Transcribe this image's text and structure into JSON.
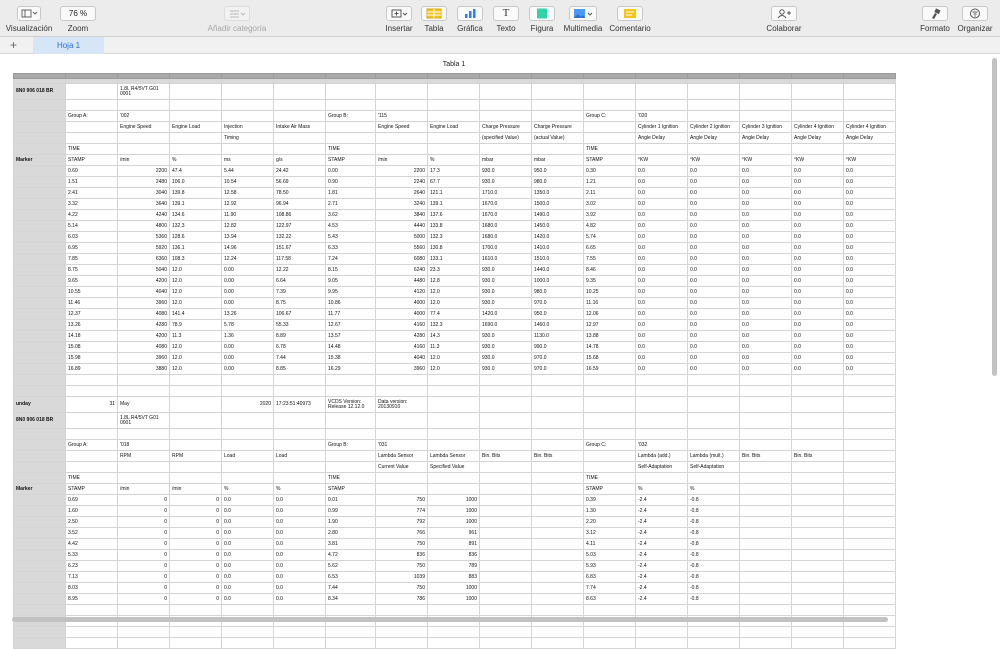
{
  "toolbar": {
    "view": "Visualización",
    "zoom_value": "76 %",
    "zoom": "Zoom",
    "add_category": "Añadir categoría",
    "insert": "Insertar",
    "table": "Tabla",
    "chart": "Gráfica",
    "text": "Texto",
    "shape": "Figura",
    "media": "Multimedia",
    "comment": "Comentario",
    "collaborate": "Colaborar",
    "format": "Formato",
    "organize": "Organizar",
    "text_icon_glyph": "T",
    "accent_color": "#f5c518",
    "shape_color": "#2ed3a8"
  },
  "tabs": {
    "add": "+",
    "sheet1": "Hoja 1"
  },
  "table_title": "Tabla 1",
  "rows": [
    [
      "8N0 906 018 BR",
      "",
      "1.8L R4/5VT     G01\n0001",
      "",
      "",
      "",
      "",
      "",
      "",
      "",
      "",
      "",
      "",
      "",
      "",
      "",
      ""
    ],
    [
      "",
      "",
      "",
      "",
      "",
      "",
      "",
      "",
      "",
      "",
      "",
      "",
      "",
      "",
      "",
      "",
      ""
    ],
    [
      "",
      "Group A:",
      "'002",
      "",
      "",
      "",
      "Group B:",
      "'115",
      "",
      "",
      "",
      "Group C:",
      "'020",
      "",
      "",
      "",
      ""
    ],
    [
      "",
      "",
      "Engine Speed",
      "Engine Load",
      "Injection",
      "Intake Air Mass",
      "",
      "Engine Speed",
      "Engine Load",
      "Charge Pressure",
      "Charge Pressure",
      "",
      "Cylinder 1 Ignition",
      "Cylinder 2 Ignition",
      "Cylinder 3 Ignition",
      "Cylinder 4 Ignition",
      "Cylinder 4 Ignition"
    ],
    [
      "",
      "",
      "",
      "",
      "Timing",
      "",
      "",
      "",
      "",
      "(specified Value)",
      "(actual Value)",
      "",
      "Angle Delay",
      "Angle Delay",
      "Angle Delay",
      "Angle Delay",
      "Angle Delay"
    ],
    [
      "",
      "TIME",
      "",
      "",
      "",
      "",
      "TIME",
      "",
      "",
      "",
      "",
      "TIME",
      "",
      "",
      "",
      "",
      ""
    ],
    [
      "Marker",
      "STAMP",
      "/min",
      "%",
      "ms",
      "g/s",
      "STAMP",
      "/min",
      "%",
      "mbar",
      "mbar",
      "STAMP",
      "°KW",
      "°KW",
      "°KW",
      "°KW",
      "°KW"
    ],
    [
      "",
      "0.60",
      "2200",
      "47.4",
      "5.44",
      "24.42",
      "0.00",
      "2200",
      "17.3",
      "930.0",
      "950.0",
      "0.30",
      "0.0",
      "0.0",
      "0.0",
      "0.0",
      "0.0"
    ],
    [
      "",
      "1.51",
      "2480",
      "106.0",
      "10.54",
      "56.69",
      "0.90",
      "2240",
      "67.7",
      "930.0",
      "980.0",
      "1.21",
      "0.0",
      "0.0",
      "0.0",
      "0.0",
      "0.0"
    ],
    [
      "",
      "2.41",
      "3040",
      "139.8",
      "12.58",
      "78.50",
      "1.81",
      "2640",
      "121.1",
      "1710.0",
      "1350.0",
      "2.11",
      "0.0",
      "0.0",
      "0.0",
      "0.0",
      "0.0"
    ],
    [
      "",
      "3.32",
      "3640",
      "139.1",
      "12.92",
      "96.94",
      "2.71",
      "3240",
      "139.1",
      "1670.0",
      "1500.0",
      "3.02",
      "0.0",
      "0.0",
      "0.0",
      "0.0",
      "0.0"
    ],
    [
      "",
      "4.22",
      "4240",
      "134.6",
      "11.90",
      "108.86",
      "3.62",
      "3840",
      "137.6",
      "1670.0",
      "1490.0",
      "3.92",
      "0.0",
      "0.0",
      "0.0",
      "0.0",
      "0.0"
    ],
    [
      "",
      "5.14",
      "4800",
      "132.3",
      "12.82",
      "122.97",
      "4.53",
      "4440",
      "133.8",
      "1680.0",
      "1450.0",
      "4.82",
      "0.0",
      "0.0",
      "0.0",
      "0.0",
      "0.0"
    ],
    [
      "",
      "6.03",
      "5360",
      "128.6",
      "13.94",
      "132.22",
      "5.43",
      "5000",
      "132.3",
      "1680.0",
      "1420.0",
      "5.74",
      "0.0",
      "0.0",
      "0.0",
      "0.0",
      "0.0"
    ],
    [
      "",
      "6.95",
      "5920",
      "136.1",
      "14.96",
      "151.67",
      "6.33",
      "5560",
      "130.8",
      "1700.0",
      "1410.0",
      "6.65",
      "0.0",
      "0.0",
      "0.0",
      "0.0",
      "0.0"
    ],
    [
      "",
      "7.85",
      "6360",
      "108.3",
      "12.24",
      "117.58",
      "7.24",
      "6080",
      "133.1",
      "1610.0",
      "1510.0",
      "7.55",
      "0.0",
      "0.0",
      "0.0",
      "0.0",
      "0.0"
    ],
    [
      "",
      "8.75",
      "5040",
      "12.0",
      "0.00",
      "12.22",
      "8.15",
      "6240",
      "23.3",
      "930.0",
      "1440.0",
      "8.46",
      "0.0",
      "0.0",
      "0.0",
      "0.0",
      "0.0"
    ],
    [
      "",
      "9.65",
      "4200",
      "12.0",
      "0.00",
      "6.64",
      "9.05",
      "4480",
      "12.8",
      "930.0",
      "1000.0",
      "9.35",
      "0.0",
      "0.0",
      "0.0",
      "0.0",
      "0.0"
    ],
    [
      "",
      "10.55",
      "4040",
      "12.0",
      "0.00",
      "7.39",
      "9.95",
      "4120",
      "12.0",
      "930.0",
      "980.0",
      "10.25",
      "0.0",
      "0.0",
      "0.0",
      "0.0",
      "0.0"
    ],
    [
      "",
      "11.46",
      "3960",
      "12.0",
      "0.00",
      "8.75",
      "10.86",
      "4000",
      "12.0",
      "930.0",
      "970.0",
      "11.16",
      "0.0",
      "0.0",
      "0.0",
      "0.0",
      "0.0"
    ],
    [
      "",
      "12.37",
      "4080",
      "141.4",
      "13.26",
      "106.67",
      "11.77",
      "4000",
      "77.4",
      "1420.0",
      "950.0",
      "12.06",
      "0.0",
      "0.0",
      "0.0",
      "0.0",
      "0.0"
    ],
    [
      "",
      "13.26",
      "4280",
      "78.9",
      "5.78",
      "55.33",
      "12.67",
      "4160",
      "132.3",
      "1690.0",
      "1460.0",
      "12.97",
      "0.0",
      "0.0",
      "0.0",
      "0.0",
      "0.0"
    ],
    [
      "",
      "14.18",
      "4200",
      "11.3",
      "1.36",
      "8.89",
      "13.57",
      "4280",
      "14.3",
      "930.0",
      "1130.0",
      "13.88",
      "0.0",
      "0.0",
      "0.0",
      "0.0",
      "0.0"
    ],
    [
      "",
      "15.08",
      "4080",
      "12.0",
      "0.00",
      "6.78",
      "14.48",
      "4160",
      "11.3",
      "930.0",
      "990.0",
      "14.78",
      "0.0",
      "0.0",
      "0.0",
      "0.0",
      "0.0"
    ],
    [
      "",
      "15.98",
      "3960",
      "12.0",
      "0.00",
      "7.44",
      "15.38",
      "4040",
      "12.0",
      "930.0",
      "970.0",
      "15.68",
      "0.0",
      "0.0",
      "0.0",
      "0.0",
      "0.0"
    ],
    [
      "",
      "16.89",
      "3880",
      "12.0",
      "0.00",
      "8.85",
      "16.29",
      "3960",
      "12.0",
      "930.0",
      "970.0",
      "16.59",
      "0.0",
      "0.0",
      "0.0",
      "0.0",
      "0.0"
    ],
    [
      "",
      "",
      "",
      "",
      "",
      "",
      "",
      "",
      "",
      "",
      "",
      "",
      "",
      "",
      "",
      "",
      ""
    ],
    [
      "",
      "",
      "",
      "",
      "",
      "",
      "",
      "",
      "",
      "",
      "",
      "",
      "",
      "",
      "",
      "",
      ""
    ],
    [
      "unday",
      "31",
      "May",
      "",
      "2020",
      "17:23:51:40973",
      "VCDS Version:\nRelease 12.12.0",
      "Data version:\n20130910",
      "",
      "",
      "",
      "",
      "",
      "",
      "",
      "",
      ""
    ],
    [
      "8N0 906 018 BR",
      "",
      "1.8L R4/5VT     G01\n0001",
      "",
      "",
      "",
      "",
      "",
      "",
      "",
      "",
      "",
      "",
      "",
      "",
      "",
      ""
    ],
    [
      "",
      "",
      "",
      "",
      "",
      "",
      "",
      "",
      "",
      "",
      "",
      "",
      "",
      "",
      "",
      "",
      ""
    ],
    [
      "",
      "Group A:",
      "'018",
      "",
      "",
      "",
      "Group B:",
      "'031",
      "",
      "",
      "",
      "Group C:",
      "'032",
      "",
      "",
      "",
      ""
    ],
    [
      "",
      "",
      "RPM",
      "RPM",
      "Load",
      "Load",
      "",
      "Lambda Sensor",
      "Lambda Sensor",
      "Bin. Bits",
      "Bin. Bits",
      "",
      "Lambda (add.)",
      "Lambda (mult.)",
      "Bin. Bits",
      "Bin. Bits",
      ""
    ],
    [
      "",
      "",
      "",
      "",
      "",
      "",
      "",
      "Current Value",
      "Specified Value",
      "",
      "",
      "",
      "Self-Adaptation",
      "Self-Adaptation",
      "",
      "",
      ""
    ],
    [
      "",
      "TIME",
      "",
      "",
      "",
      "",
      "TIME",
      "",
      "",
      "",
      "",
      "TIME",
      "",
      "",
      "",
      "",
      ""
    ],
    [
      "Marker",
      "STAMP",
      "/min",
      "/min",
      "%",
      "%",
      "STAMP",
      "",
      "",
      "",
      "",
      "STAMP",
      "%",
      "%",
      "",
      "",
      ""
    ],
    [
      "",
      "0.69",
      "0",
      "0",
      "0.0",
      "0.0",
      "0.01",
      "750",
      "1000",
      "",
      "",
      "0.39",
      "-2.4",
      "-0.8",
      "",
      "",
      ""
    ],
    [
      "",
      "1.60",
      "0",
      "0",
      "0.0",
      "0.0",
      "0.99",
      "774",
      "1000",
      "",
      "",
      "1.30",
      "-2.4",
      "-0.8",
      "",
      "",
      ""
    ],
    [
      "",
      "2.50",
      "0",
      "0",
      "0.0",
      "0.0",
      "1.90",
      "792",
      "1000",
      "",
      "",
      "2.20",
      "-2.4",
      "-0.8",
      "",
      "",
      ""
    ],
    [
      "",
      "3.52",
      "0",
      "0",
      "0.0",
      "0.0",
      "2.80",
      "766",
      "961",
      "",
      "",
      "3.12",
      "-2.4",
      "-0.8",
      "",
      "",
      ""
    ],
    [
      "",
      "4.42",
      "0",
      "0",
      "0.0",
      "0.0",
      "3.81",
      "750",
      "891",
      "",
      "",
      "4.11",
      "-2.4",
      "-0.8",
      "",
      "",
      ""
    ],
    [
      "",
      "5.33",
      "0",
      "0",
      "0.0",
      "0.0",
      "4.72",
      "836",
      "836",
      "",
      "",
      "5.03",
      "-2.4",
      "-0.8",
      "",
      "",
      ""
    ],
    [
      "",
      "6.23",
      "0",
      "0",
      "0.0",
      "0.0",
      "5.62",
      "750",
      "789",
      "",
      "",
      "5.93",
      "-2.4",
      "-0.8",
      "",
      "",
      ""
    ],
    [
      "",
      "7.13",
      "0",
      "0",
      "0.0",
      "0.0",
      "6.53",
      "1039",
      "883",
      "",
      "",
      "6.83",
      "-2.4",
      "-0.8",
      "",
      "",
      ""
    ],
    [
      "",
      "8.03",
      "0",
      "0",
      "0.0",
      "0.0",
      "7.44",
      "750",
      "1000",
      "",
      "",
      "7.74",
      "-2.4",
      "-0.8",
      "",
      "",
      ""
    ],
    [
      "",
      "8.95",
      "0",
      "0",
      "0.0",
      "0.0",
      "8.34",
      "786",
      "1000",
      "",
      "",
      "8.63",
      "-2.4",
      "-0.8",
      "",
      "",
      ""
    ],
    [
      "",
      "",
      "",
      "",
      "",
      "",
      "",
      "",
      "",
      "",
      "",
      "",
      "",
      "",
      "",
      "",
      ""
    ],
    [
      "",
      "",
      "",
      "",
      "",
      "",
      "",
      "",
      "",
      "",
      "",
      "",
      "",
      "",
      "",
      "",
      ""
    ],
    [
      "",
      "",
      "",
      "",
      "",
      "",
      "",
      "",
      "",
      "",
      "",
      "",
      "",
      "",
      "",
      "",
      ""
    ],
    [
      "",
      "",
      "",
      "",
      "",
      "",
      "",
      "",
      "",
      "",
      "",
      "",
      "",
      "",
      "",
      "",
      ""
    ]
  ]
}
